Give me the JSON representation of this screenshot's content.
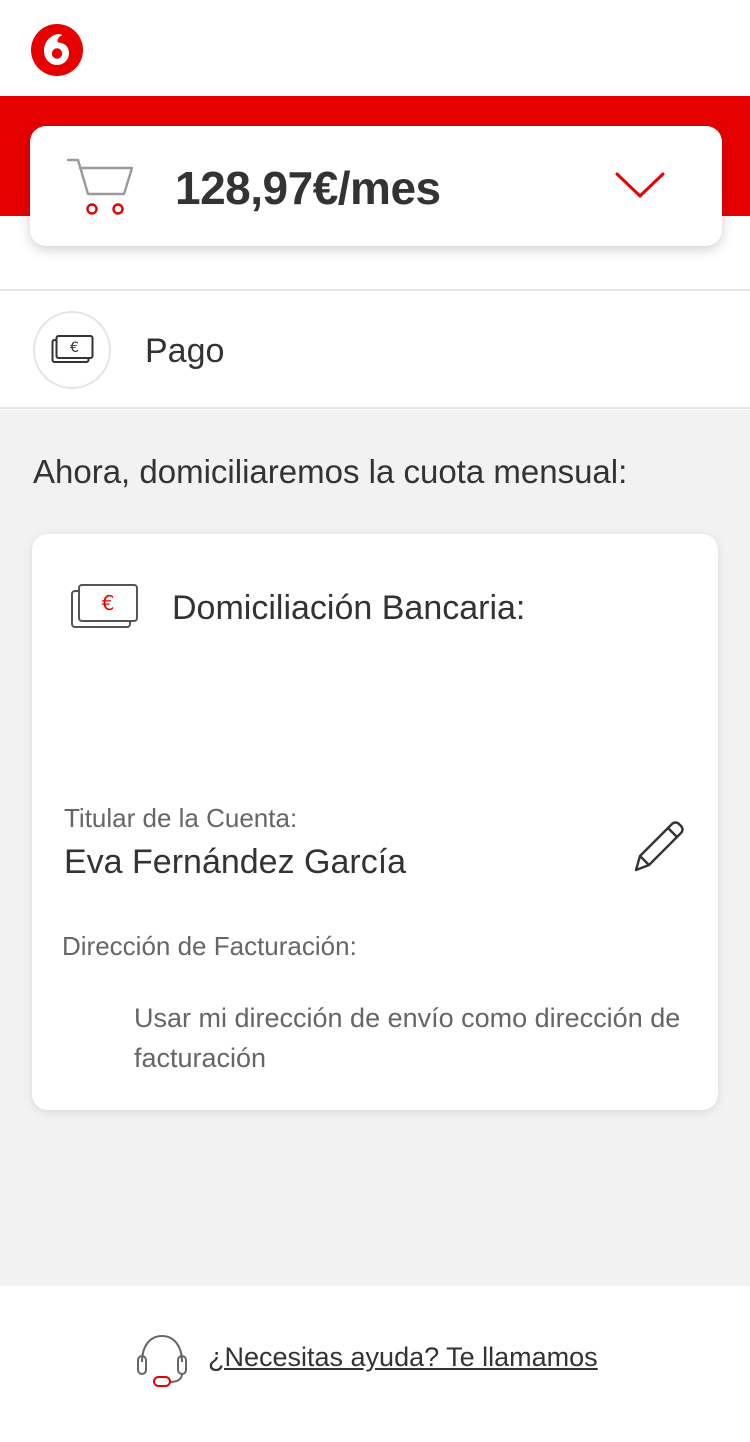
{
  "header": {
    "logo_icon": "vodafone-logo-icon"
  },
  "summary": {
    "cart_icon": "shopping-cart-icon",
    "price": "128,97€/mes",
    "toggle_icon": "chevron-down-icon"
  },
  "step": {
    "icon": "payment-money-icon",
    "label": "Pago"
  },
  "main": {
    "intro": "Ahora, domiciliaremos la cuota mensual:"
  },
  "bank_card": {
    "icon": "bank-money-icon",
    "title": "Domiciliación Bancaria:",
    "holder_label": "Titular de la Cuenta:",
    "holder_name": "Eva Fernández García",
    "edit_icon": "pencil-icon",
    "billing_label": "Dirección de Facturación:",
    "billing_option": "Usar mi dirección de envío como dirección de facturación"
  },
  "footer": {
    "help_icon": "headset-icon",
    "help_link": "¿Necesitas ayuda? Te llamamos"
  },
  "colors": {
    "brand_red": "#e60000",
    "background_grey": "#f2f2f2",
    "text_dark": "#333333",
    "text_muted": "#666666"
  }
}
